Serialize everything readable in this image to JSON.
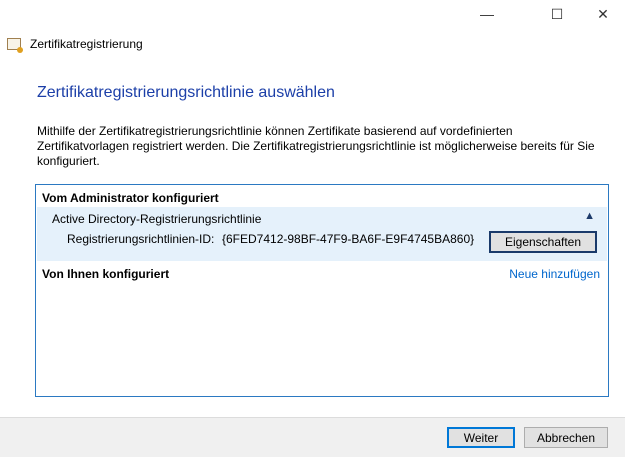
{
  "window": {
    "title": "Zertifikatregistrierung",
    "minimize": "—",
    "maximize": "☐",
    "close": "✕"
  },
  "page": {
    "heading": "Zertifikatregistrierungsrichtlinie auswählen",
    "description": "Mithilfe der Zertifikatregistrierungsrichtlinie können Zertifikate basierend auf vordefinierten Zertifikatvorlagen registriert werden. Die Zertifikatregistrierungsrichtlinie ist möglicherweise bereits für Sie konfiguriert."
  },
  "policies": {
    "admin_section": "Vom Administrator konfiguriert",
    "item": {
      "name": "Active Directory-Registrierungsrichtlinie",
      "collapse_icon": "▲",
      "id_label": "Registrierungsrichtlinien-ID:",
      "id_value": "{6FED7412-98BF-47F9-BA6F-E9F4745BA860}",
      "properties_button": "Eigenschaften"
    },
    "user_section": "Von Ihnen konfiguriert",
    "add_link": "Neue hinzufügen"
  },
  "footer": {
    "next": "Weiter",
    "cancel": "Abbrechen"
  }
}
